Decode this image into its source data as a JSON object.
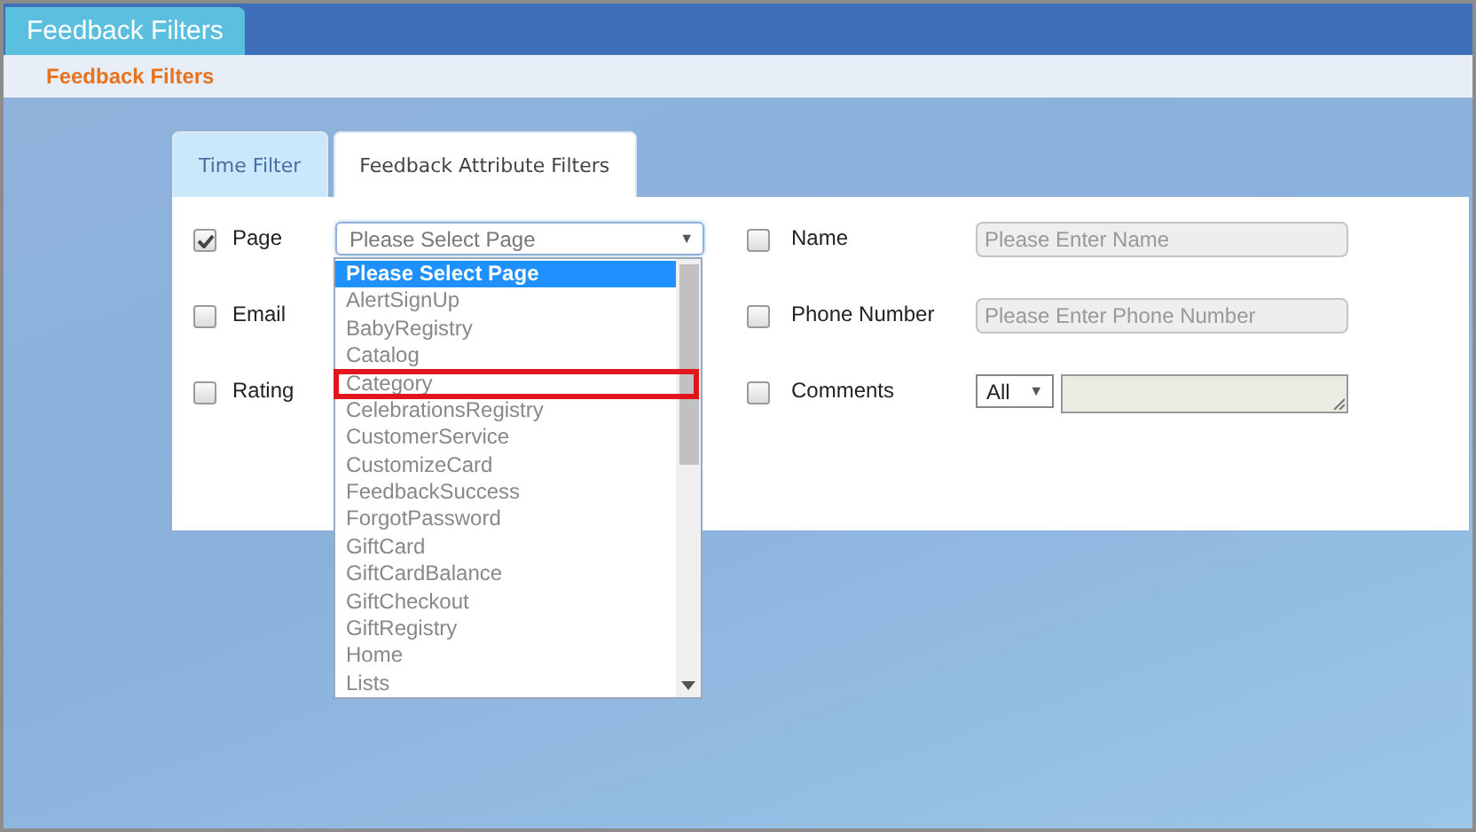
{
  "window": {
    "title": "Feedback Filters"
  },
  "breadcrumb": "Feedback Filters",
  "tabs": [
    {
      "label": "Time Filter",
      "selected": false
    },
    {
      "label": "Feedback Attribute Filters",
      "selected": true
    }
  ],
  "fields": [
    {
      "label": "Page",
      "checked": true,
      "kind": "select",
      "value": "Please Select Page",
      "caret": "▼",
      "open": true,
      "options": [
        {
          "label": "Please Select Page",
          "selected": true,
          "highlighted": false
        },
        {
          "label": "AlertSignUp",
          "selected": false,
          "highlighted": false
        },
        {
          "label": "BabyRegistry",
          "selected": false,
          "highlighted": false
        },
        {
          "label": "Catalog",
          "selected": false,
          "highlighted": false
        },
        {
          "label": "Category",
          "selected": false,
          "highlighted": true
        },
        {
          "label": "CelebrationsRegistry",
          "selected": false,
          "highlighted": false
        },
        {
          "label": "CustomerService",
          "selected": false,
          "highlighted": false
        },
        {
          "label": "CustomizeCard",
          "selected": false,
          "highlighted": false
        },
        {
          "label": "FeedbackSuccess",
          "selected": false,
          "highlighted": false
        },
        {
          "label": "ForgotPassword",
          "selected": false,
          "highlighted": false
        },
        {
          "label": "GiftCard",
          "selected": false,
          "highlighted": false
        },
        {
          "label": "GiftCardBalance",
          "selected": false,
          "highlighted": false
        },
        {
          "label": "GiftCheckout",
          "selected": false,
          "highlighted": false
        },
        {
          "label": "GiftRegistry",
          "selected": false,
          "highlighted": false
        },
        {
          "label": "Home",
          "selected": false,
          "highlighted": false
        },
        {
          "label": "Lists",
          "selected": false,
          "highlighted": false
        }
      ]
    },
    {
      "label": "Name",
      "checked": false,
      "kind": "text",
      "placeholder": "Please Enter Name"
    },
    {
      "label": "Email",
      "checked": false,
      "kind": "none"
    },
    {
      "label": "Phone Number",
      "checked": false,
      "kind": "text",
      "placeholder": "Please Enter Phone Number"
    },
    {
      "label": "Rating",
      "checked": false,
      "kind": "none"
    },
    {
      "label": "Comments",
      "checked": false,
      "kind": "comment",
      "value": "All",
      "caret": "▼"
    }
  ]
}
